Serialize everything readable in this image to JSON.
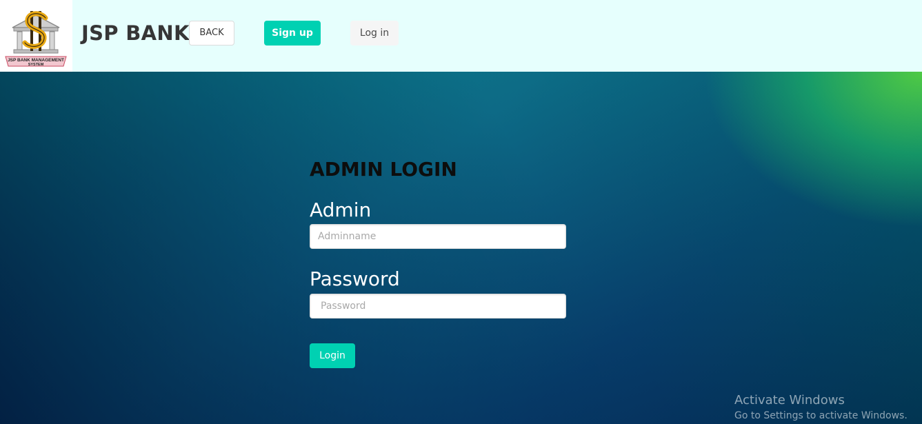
{
  "header": {
    "logo_text": "JSP BANK MANAGEMENT SYSTEM",
    "brand": "JSP BANK",
    "back_label": "BACK",
    "signup_label": "Sign up",
    "login_label": "Log in"
  },
  "form": {
    "title": "ADMIN LOGIN",
    "admin_label": "Admin",
    "admin_placeholder": "Adminname",
    "admin_value": "",
    "password_label": "Password",
    "password_placeholder": "Password",
    "password_value": "",
    "submit_label": "Login"
  },
  "watermark": {
    "title": "Activate Windows",
    "subtitle": "Go to Settings to activate Windows."
  },
  "colors": {
    "navbar_bg": "#e6fffd",
    "accent": "#00d1b2",
    "hero_dark": "#02224a",
    "hero_light": "#6edc2d"
  }
}
